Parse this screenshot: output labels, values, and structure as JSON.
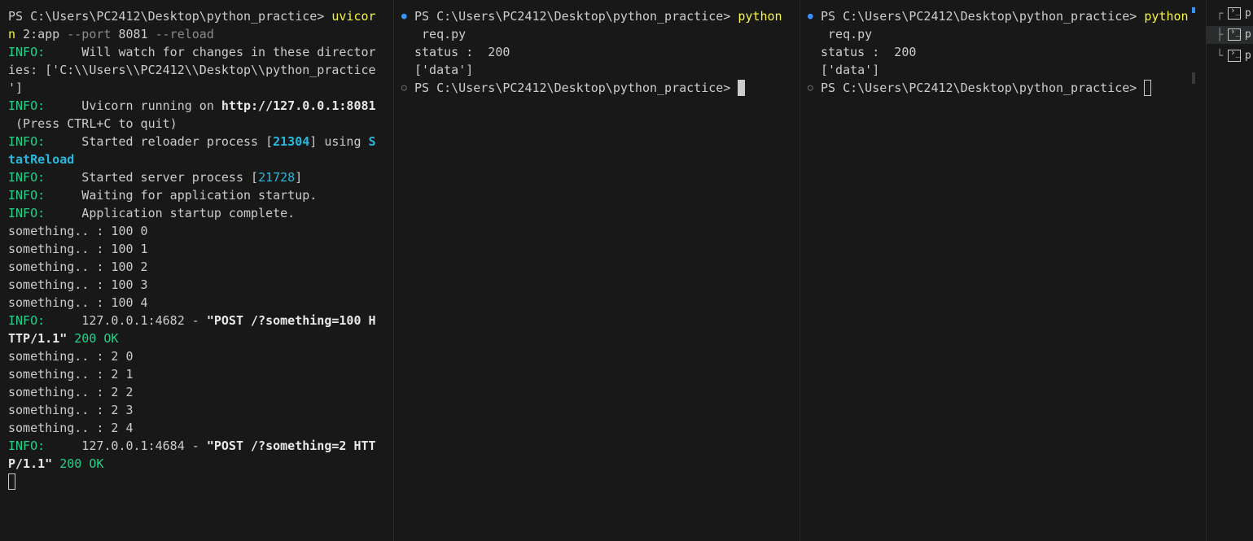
{
  "pane1": {
    "l1a": "PS C:\\Users\\PC2412\\Desktop\\python_practice> ",
    "l1b": "uvicor",
    "l2a": "n",
    "l2b": " 2:app ",
    "l2c": "--port",
    "l2d": " 8081 ",
    "l2e": "--reload",
    "info": "INFO:",
    "l3": "     Will watch for changes in these director",
    "l4": "ies: ['C:\\\\Users\\\\PC2412\\\\Desktop\\\\python_practice",
    "l5": "']",
    "l6a": "     Uvicorn running on ",
    "l6b": "http://127.0.0.1:8081",
    "l7": " (Press CTRL+C to quit)",
    "l8a": "     Started reloader process [",
    "l8b": "21304",
    "l8c": "] using ",
    "l8d": "S",
    "l9": "tatReload",
    "l10a": "     Started server process [",
    "l10b": "21728",
    "l10c": "]",
    "l11": "     Waiting for application startup.",
    "l12": "     Application startup complete.",
    "s1": "something.. : 100 0",
    "s2": "something.. : 100 1",
    "s3": "something.. : 100 2",
    "s4": "something.. : 100 3",
    "s5": "something.. : 100 4",
    "r1a": "     127.0.0.1:4682 - ",
    "r1b": "\"POST /?something=100 H",
    "r2a": "TTP/1.1\"",
    "r2b": " 200 OK",
    "s6": "something.. : 2 0",
    "s7": "something.. : 2 1",
    "s8": "something.. : 2 2",
    "s9": "something.. : 2 3",
    "s10": "something.. : 2 4",
    "r3a": "     127.0.0.1:4684 - ",
    "r3b": "\"POST /?something=2 HTT",
    "r4a": "P/1.1\"",
    "r4b": " 200 OK"
  },
  "pane2": {
    "p1a": "PS C:\\Users\\PC2412\\Desktop\\python_practice> ",
    "p1b": "python",
    "p2": " req.py",
    "p3": "status :  200",
    "p4": "['data']",
    "p5": "PS C:\\Users\\PC2412\\Desktop\\python_practice> "
  },
  "pane3": {
    "p1a": "PS C:\\Users\\PC2412\\Desktop\\python_practice> ",
    "p1b": "python",
    "p2": " req.py",
    "p3": "status :  200",
    "p4": "['data']",
    "p5": "PS C:\\Users\\PC2412\\Desktop\\python_practice> "
  },
  "terminal_list": {
    "t1": "p",
    "t2": "p",
    "t3": "p"
  },
  "colors": {
    "background": "#181818",
    "info_green": "#23d18b",
    "command_yellow": "#f5f543",
    "number_cyan": "#29b8db",
    "decoration_blue": "#3794ff"
  }
}
